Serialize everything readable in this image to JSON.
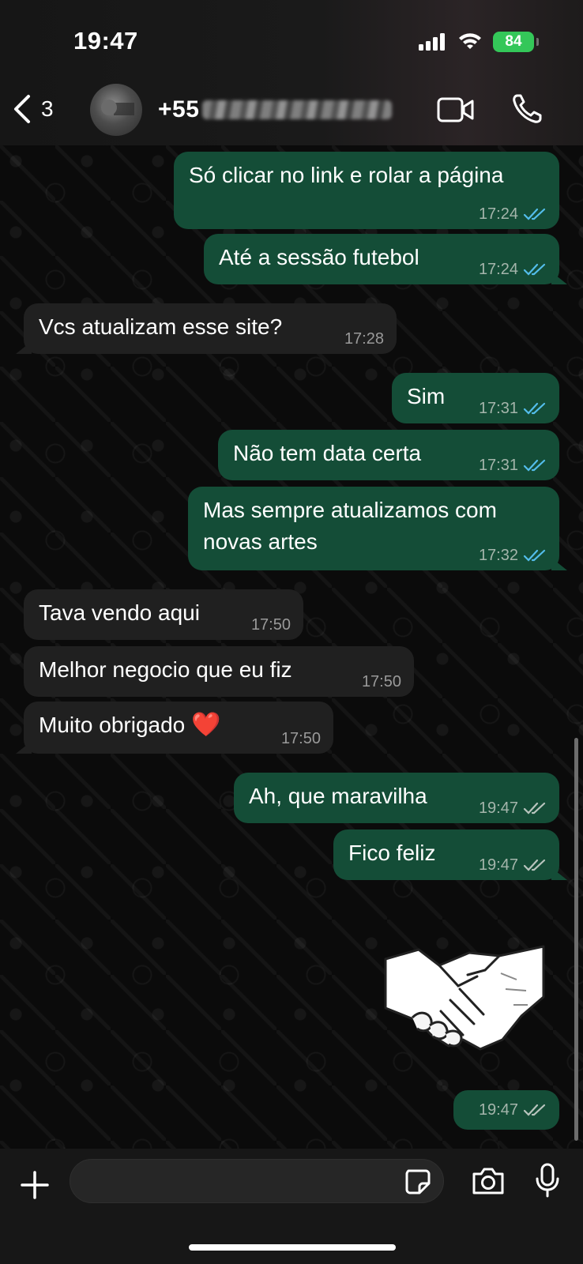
{
  "status_bar": {
    "time": "19:47",
    "battery": "84",
    "icons": [
      "signal-icon",
      "wifi-icon",
      "battery-icon"
    ]
  },
  "header": {
    "back_count": "3",
    "contact_name_visible": "+55",
    "icons": [
      "back-chevron-icon",
      "avatar",
      "video-call-icon",
      "phone-call-icon"
    ]
  },
  "messages": [
    {
      "dir": "out",
      "text": "Só clicar no link e rolar a página",
      "time": "17:24",
      "status": "read"
    },
    {
      "dir": "out",
      "text": "Até a sessão futebol",
      "time": "17:24",
      "status": "read"
    },
    {
      "dir": "in",
      "text": "Vcs atualizam esse site?",
      "time": "17:28"
    },
    {
      "dir": "out",
      "text": "Sim",
      "time": "17:31",
      "status": "read"
    },
    {
      "dir": "out",
      "text": "Não tem data certa",
      "time": "17:31",
      "status": "read"
    },
    {
      "dir": "out",
      "text": "Mas sempre atualizamos com novas artes",
      "time": "17:32",
      "status": "read"
    },
    {
      "dir": "in",
      "text": "Tava vendo aqui",
      "time": "17:50"
    },
    {
      "dir": "in",
      "text": "Melhor negocio que eu fiz",
      "time": "17:50"
    },
    {
      "dir": "in",
      "text": "Muito obrigado",
      "emoji": "❤️",
      "time": "17:50"
    },
    {
      "dir": "out",
      "text": "Ah, que maravilha",
      "time": "19:47",
      "status": "delivered"
    },
    {
      "dir": "out",
      "text": "Fico feliz",
      "time": "19:47",
      "status": "delivered"
    },
    {
      "dir": "out",
      "type": "sticker",
      "sticker": "handshake-sticker",
      "time": "19:47",
      "status": "delivered"
    }
  ],
  "colors": {
    "outgoing_bubble": "#144d37",
    "incoming_bubble": "#202020",
    "read_ticks": "#53bdeb",
    "delivered_ticks": "#b8c4bd",
    "battery": "#34c759"
  },
  "composer": {
    "placeholder": "",
    "value": "",
    "icons": [
      "plus-icon",
      "sticker-icon",
      "camera-icon",
      "microphone-icon"
    ]
  }
}
